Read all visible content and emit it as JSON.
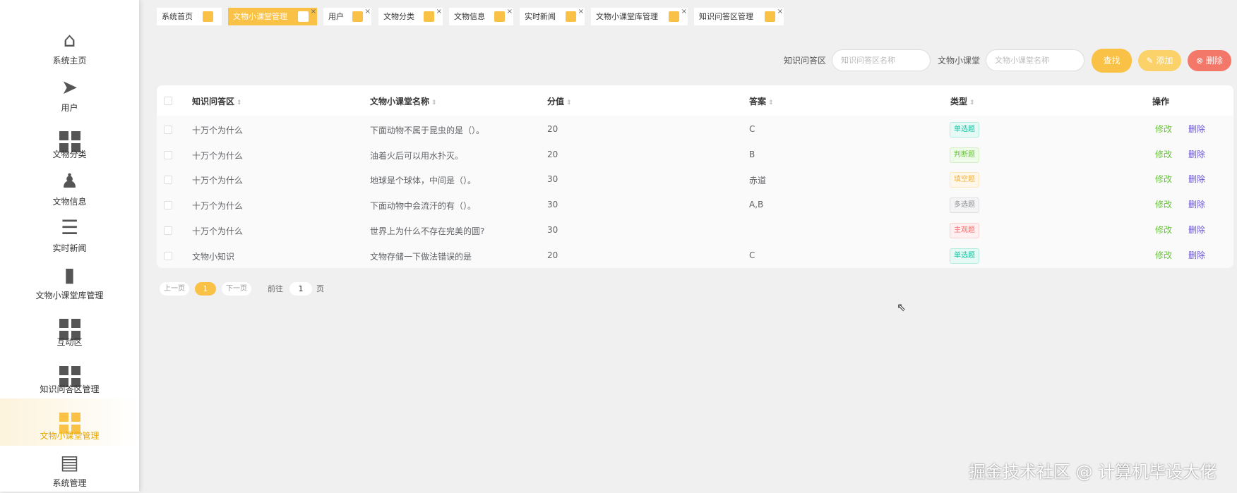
{
  "sidebar": {
    "items": [
      {
        "label": "系统主页",
        "icon": "home-icon"
      },
      {
        "label": "用户",
        "icon": "paper-plane-icon"
      },
      {
        "label": "文物分类",
        "icon": "grid-icon"
      },
      {
        "label": "文物信息",
        "icon": "stamp-icon"
      },
      {
        "label": "实时新闻",
        "icon": "list-icon"
      },
      {
        "label": "文物小课堂库管理",
        "icon": "bar-chart-icon"
      },
      {
        "label": "互动区",
        "icon": "grid-icon"
      },
      {
        "label": "知识问答区管理",
        "icon": "grid-icon"
      },
      {
        "label": "文物小课堂管理",
        "icon": "grid-icon",
        "active": true
      },
      {
        "label": "系统管理",
        "icon": "store-icon"
      }
    ]
  },
  "tabs": [
    "系统首页",
    "文物小课堂管理",
    "用户",
    "文物分类",
    "文物信息",
    "实时新闻",
    "文物小课堂库管理",
    "知识问答区管理"
  ],
  "search": {
    "label1": "知识问答区",
    "placeholder1": "知识问答区名称",
    "label2": "文物小课堂",
    "placeholder2": "文物小课堂名称",
    "find": "查找",
    "add": "添加",
    "delete": "删除"
  },
  "table": {
    "headers": [
      "知识问答区",
      "文物小课堂名称",
      "分值",
      "答案",
      "类型",
      "操作"
    ],
    "rows": [
      {
        "c1": "十万个为什么",
        "c2": "下面动物不属于昆虫的是（）。",
        "c3": "20",
        "c4": "C",
        "type": "单选题"
      },
      {
        "c1": "十万个为什么",
        "c2": "油着火后可以用水扑灭。",
        "c3": "20",
        "c4": "B",
        "type": "判断题"
      },
      {
        "c1": "十万个为什么",
        "c2": "地球是个球体，中间是（）。",
        "c3": "30",
        "c4": "赤道",
        "type": "填空题"
      },
      {
        "c1": "十万个为什么",
        "c2": "下面动物中会流汗的有（）。",
        "c3": "30",
        "c4": "A,B",
        "type": "多选题"
      },
      {
        "c1": "十万个为什么",
        "c2": "世界上为什么不存在完美的圆?",
        "c3": "30",
        "c4": "",
        "type": "主观题"
      },
      {
        "c1": "文物小知识",
        "c2": "文物存储一下做法错误的是",
        "c3": "20",
        "c4": "C",
        "type": "单选题"
      }
    ],
    "edit": "修改",
    "del": "删除"
  },
  "pagination": {
    "prev": "上一页",
    "current": "1",
    "next": "下一页",
    "goto": "前往",
    "goto_value": "1",
    "page_unit": "页"
  },
  "watermark": "掘金技术社区 @ 计算机毕设大佬",
  "colors": {
    "accent": "#f9c247",
    "danger": "#f4786a"
  }
}
